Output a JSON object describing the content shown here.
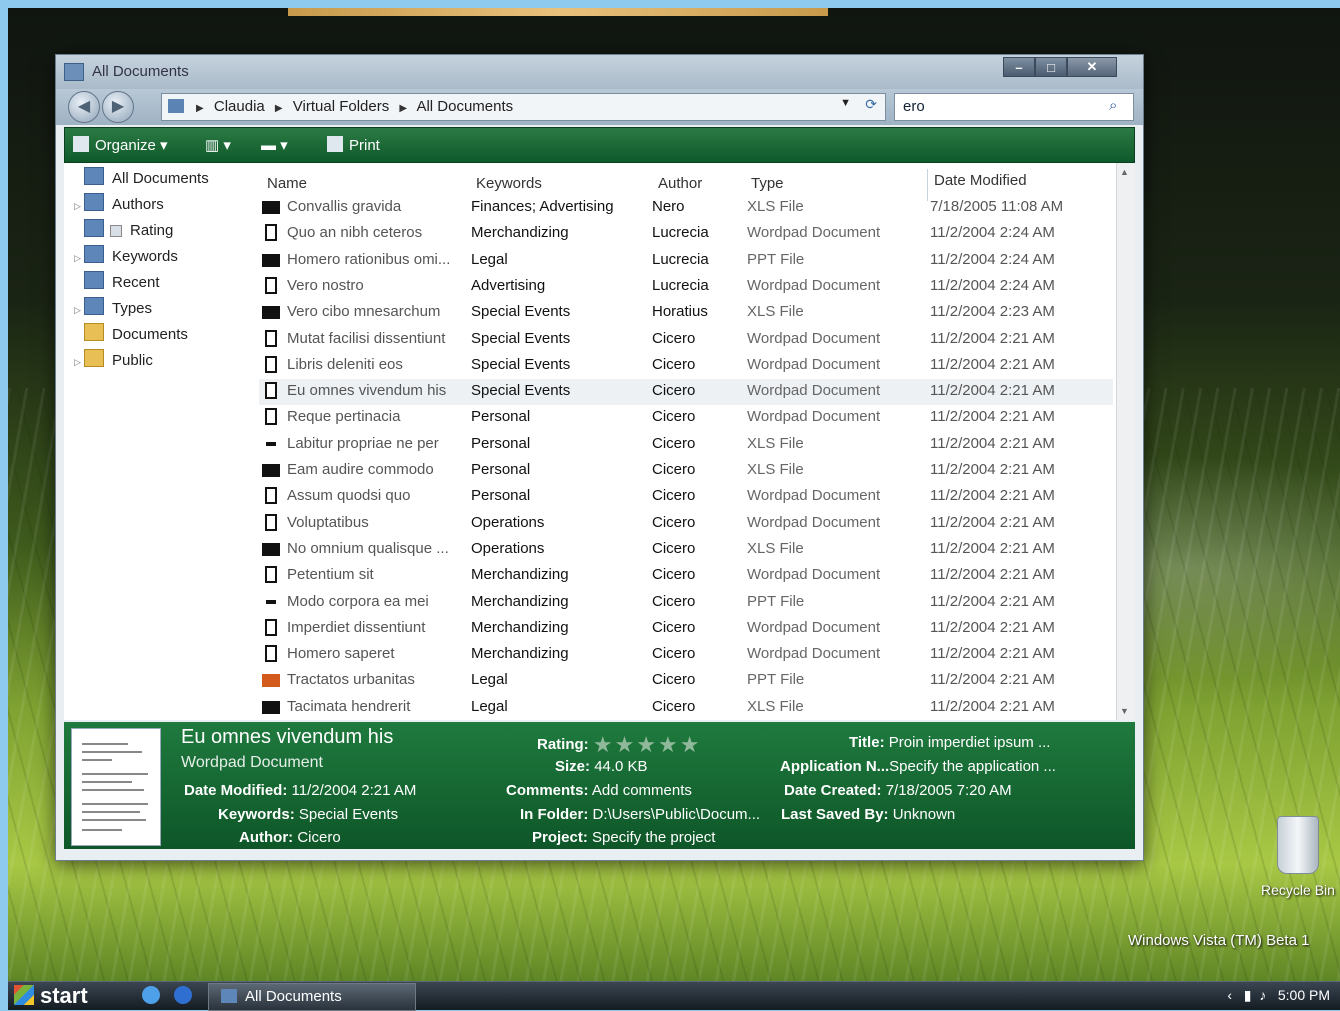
{
  "window": {
    "title": "All Documents",
    "breadcrumb": [
      "Claudia",
      "Virtual Folders",
      "All Documents"
    ],
    "search_value": "ero"
  },
  "toolbar": {
    "organize": "Organize",
    "print": "Print"
  },
  "nav": {
    "items": [
      {
        "label": "All Documents",
        "icon": "search-folder-icon"
      },
      {
        "label": "Authors",
        "icon": "search-folder-icon"
      },
      {
        "label": "Rating",
        "icon": "search-folder-icon"
      },
      {
        "label": "Keywords",
        "icon": "search-folder-icon"
      },
      {
        "label": "Recent",
        "icon": "search-folder-icon"
      },
      {
        "label": "Types",
        "icon": "search-folder-icon"
      },
      {
        "label": "Documents",
        "icon": "folder-icon"
      },
      {
        "label": "Public",
        "icon": "folder-icon"
      }
    ]
  },
  "columns": [
    "Name",
    "Keywords",
    "Author",
    "Type",
    "Date Modified"
  ],
  "files": [
    {
      "name": "Convallis gravida",
      "keywords": "Finances; Advertising",
      "author": "Nero",
      "type": "XLS File",
      "date": "7/18/2005 11:08 AM",
      "icon": "xls"
    },
    {
      "name": "Quo an nibh ceteros",
      "keywords": "Merchandizing",
      "author": "Lucrecia",
      "type": "Wordpad Document",
      "date": "11/2/2004 2:24 AM",
      "icon": "doc"
    },
    {
      "name": "Homero rationibus omi...",
      "keywords": "Legal",
      "author": "Lucrecia",
      "type": "PPT File",
      "date": "11/2/2004 2:24 AM",
      "icon": "xls"
    },
    {
      "name": "Vero nostro",
      "keywords": "Advertising",
      "author": "Lucrecia",
      "type": "Wordpad Document",
      "date": "11/2/2004 2:24 AM",
      "icon": "doc"
    },
    {
      "name": "Vero cibo mnesarchum",
      "keywords": "Special Events",
      "author": "Horatius",
      "type": "XLS File",
      "date": "11/2/2004 2:23 AM",
      "icon": "xls"
    },
    {
      "name": "Mutat facilisi dissentiunt",
      "keywords": "Special Events",
      "author": "Cicero",
      "type": "Wordpad Document",
      "date": "11/2/2004 2:21 AM",
      "icon": "doc"
    },
    {
      "name": "Libris deleniti eos",
      "keywords": "Special Events",
      "author": "Cicero",
      "type": "Wordpad Document",
      "date": "11/2/2004 2:21 AM",
      "icon": "doc"
    },
    {
      "name": "Eu omnes vivendum his",
      "keywords": "Special Events",
      "author": "Cicero",
      "type": "Wordpad Document",
      "date": "11/2/2004 2:21 AM",
      "icon": "doc"
    },
    {
      "name": "Reque pertinacia",
      "keywords": "Personal",
      "author": "Cicero",
      "type": "Wordpad Document",
      "date": "11/2/2004 2:21 AM",
      "icon": "doc"
    },
    {
      "name": "Labitur propriae ne per",
      "keywords": "Personal",
      "author": "Cicero",
      "type": "XLS File",
      "date": "11/2/2004 2:21 AM",
      "icon": "dash"
    },
    {
      "name": "Eam audire commodo",
      "keywords": "Personal",
      "author": "Cicero",
      "type": "XLS File",
      "date": "11/2/2004 2:21 AM",
      "icon": "xls"
    },
    {
      "name": "Assum quodsi quo",
      "keywords": "Personal",
      "author": "Cicero",
      "type": "Wordpad Document",
      "date": "11/2/2004 2:21 AM",
      "icon": "doc"
    },
    {
      "name": "Voluptatibus",
      "keywords": "Operations",
      "author": "Cicero",
      "type": "Wordpad Document",
      "date": "11/2/2004 2:21 AM",
      "icon": "doc"
    },
    {
      "name": "No omnium qualisque ...",
      "keywords": "Operations",
      "author": "Cicero",
      "type": "XLS File",
      "date": "11/2/2004 2:21 AM",
      "icon": "xls"
    },
    {
      "name": "Petentium sit",
      "keywords": "Merchandizing",
      "author": "Cicero",
      "type": "Wordpad Document",
      "date": "11/2/2004 2:21 AM",
      "icon": "doc"
    },
    {
      "name": "Modo corpora ea mei",
      "keywords": "Merchandizing",
      "author": "Cicero",
      "type": "PPT File",
      "date": "11/2/2004 2:21 AM",
      "icon": "dash"
    },
    {
      "name": "Imperdiet dissentiunt",
      "keywords": "Merchandizing",
      "author": "Cicero",
      "type": "Wordpad Document",
      "date": "11/2/2004 2:21 AM",
      "icon": "doc"
    },
    {
      "name": "Homero saperet",
      "keywords": "Merchandizing",
      "author": "Cicero",
      "type": "Wordpad Document",
      "date": "11/2/2004 2:21 AM",
      "icon": "doc"
    },
    {
      "name": "Tractatos urbanitas",
      "keywords": "Legal",
      "author": "Cicero",
      "type": "PPT File",
      "date": "11/2/2004 2:21 AM",
      "icon": "ppt"
    },
    {
      "name": "Tacimata hendrerit",
      "keywords": "Legal",
      "author": "Cicero",
      "type": "XLS File",
      "date": "11/2/2004 2:21 AM",
      "icon": "xls"
    }
  ],
  "selected_index": 7,
  "details": {
    "title": "Eu omnes vivendum his",
    "subtitle": "Wordpad Document",
    "date_modified_label": "Date Modified:",
    "date_modified": "11/2/2004 2:21 AM",
    "keywords_label": "Keywords:",
    "keywords": "Special Events",
    "author_label": "Author:",
    "author": "Cicero",
    "rating_label": "Rating:",
    "rating_stars": "★★★★★",
    "rating": 0,
    "size_label": "Size:",
    "size": "44.0 KB",
    "comments_label": "Comments:",
    "comments": "Add comments",
    "folder_label": "In Folder:",
    "folder": "D:\\Users\\Public\\Docum...",
    "project_label": "Project:",
    "project": "Specify the project",
    "doc_title_label": "Title:",
    "doc_title": "Proin imperdiet ipsum ...",
    "application_label": "Application N...",
    "application": "Specify the application ...",
    "created_label": "Date Created:",
    "created": "7/18/2005 7:20 AM",
    "saved_by_label": "Last Saved By:",
    "saved_by": "Unknown"
  },
  "desktop": {
    "recycle_bin": "Recycle Bin",
    "watermark": "Windows Vista (TM) Beta 1"
  },
  "taskbar": {
    "start": "start",
    "task": "All Documents",
    "clock": "5:00 PM"
  },
  "colors": {
    "toolbar_green": "#0f5a2b",
    "details_green": "#1f7a3e"
  }
}
